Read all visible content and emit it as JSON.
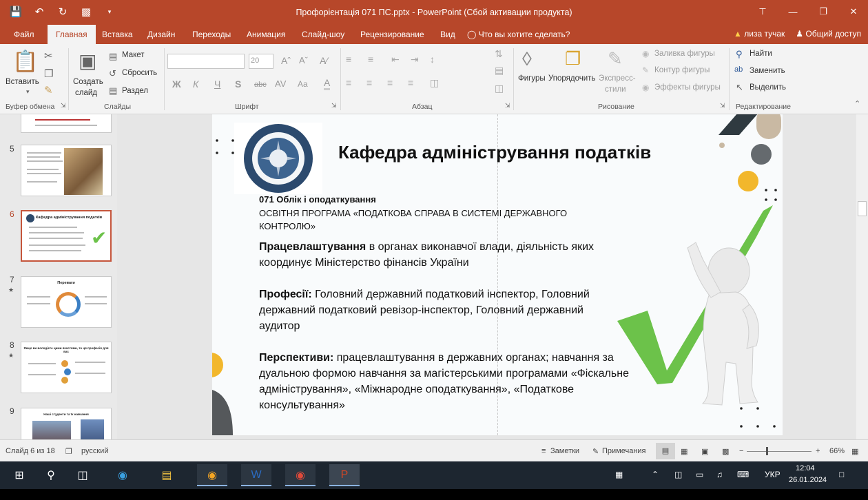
{
  "titlebar": {
    "title": "Профорієнтація 071 ПС.pptx - PowerPoint (Сбой активации продукта)"
  },
  "tabs": {
    "items": [
      "Файл",
      "Главная",
      "Вставка",
      "Дизайн",
      "Переходы",
      "Анимация",
      "Слайд-шоу",
      "Рецензирование",
      "Вид"
    ],
    "active": "Главная",
    "tell_me": "Что вы хотите сделать?",
    "user": "лиза тучак",
    "share": "Общий доступ"
  },
  "ribbon": {
    "clipboard": {
      "paste": "Вставить",
      "group": "Буфер обмена"
    },
    "slides": {
      "new_slide_1": "Создать",
      "new_slide_2": "слайд",
      "layout": "Макет",
      "reset": "Сбросить",
      "section": "Раздел",
      "group": "Слайды"
    },
    "font": {
      "size": "20",
      "group": "Шрифт",
      "bold": "Ж",
      "italic": "К",
      "underline": "Ч",
      "shadow": "S",
      "strike": "abc",
      "spacing": "AV",
      "case": "Aa"
    },
    "paragraph": {
      "group": "Абзац"
    },
    "drawing": {
      "shapes": "Фигуры",
      "arrange": "Упорядочить",
      "quick_styles_1": "Экспресс-",
      "quick_styles_2": "стили",
      "fill": "Заливка фигуры",
      "outline": "Контур фигуры",
      "effects": "Эффекты фигуры",
      "group": "Рисование"
    },
    "editing": {
      "find": "Найти",
      "replace": "Заменить",
      "select": "Выделить",
      "group": "Редактирование"
    }
  },
  "thumbnails": [
    {
      "num": "5",
      "selected": false,
      "star": false
    },
    {
      "num": "6",
      "selected": true,
      "star": false,
      "title": "Кафедра адміністрування податків"
    },
    {
      "num": "7",
      "selected": false,
      "star": true,
      "title": "Переваги"
    },
    {
      "num": "8",
      "selected": false,
      "star": true,
      "title": "Якщо ви володієте цими якостями, то ця професія для вас"
    },
    {
      "num": "9",
      "selected": false,
      "star": false,
      "title": "Наші студенти та їх навчання"
    }
  ],
  "slide": {
    "title": "Кафедра адміністрування податків",
    "subtitle": "071 Облік і оподаткування",
    "program": "ОСВІТНЯ ПРОГРАМА «ПОДАТКОВА СПРАВА В СИСТЕМІ ДЕРЖАВНОГО КОНТРОЛЮ»",
    "employment_label": "Працевлаштування",
    "employment_text": " в органах виконавчої влади, діяльність яких координує Міністерство фінансів України",
    "professions_label": "Професії:",
    "professions_text": " Головний державний податковий інспектор, Головний державний податковий ревізор-інспектор, Головний державний аудитор",
    "prospects_label": "Перспективи:",
    "prospects_text": " працевлаштування в державних органах;  навчання за дуальною формою навчання за магістерськими програмами «Фіскальне адміністрування», «Міжнародне оподаткування», «Податкове консультування»",
    "seal_text": "ФАКУЛЬТЕТ ПОДАТКОВОЇ СПРАВИ"
  },
  "status": {
    "slide_of": "Слайд 6 из 18",
    "language": "русский",
    "notes": "Заметки",
    "comments": "Примечания",
    "zoom": "66%"
  },
  "taskbar": {
    "lang": "УКР",
    "time": "12:04",
    "date": "26.01.2024"
  }
}
